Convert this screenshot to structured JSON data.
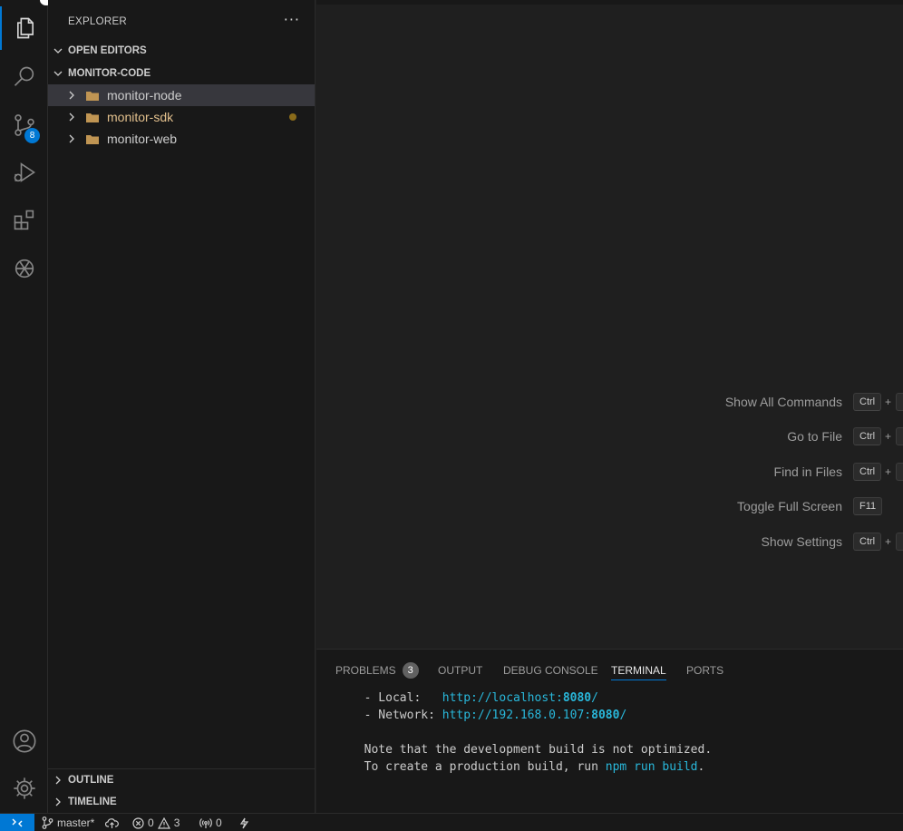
{
  "activity_bar": {
    "items": [
      {
        "icon": "files-icon"
      },
      {
        "icon": "search-icon"
      },
      {
        "icon": "source-control-icon",
        "badge": "8"
      },
      {
        "icon": "run-debug-icon"
      },
      {
        "icon": "extensions-icon"
      },
      {
        "icon": "openai-icon"
      }
    ],
    "bottom": [
      {
        "icon": "account-icon"
      },
      {
        "icon": "gear-icon"
      }
    ]
  },
  "sidebar": {
    "title": "EXPLORER",
    "more": "···",
    "open_editors": "OPEN EDITORS",
    "workspace": "MONITOR-CODE",
    "folders": [
      {
        "name": "monitor-node",
        "color": "#cccccc",
        "selected": true
      },
      {
        "name": "monitor-sdk",
        "color": "#e2c08d",
        "modified": true
      },
      {
        "name": "monitor-web",
        "color": "#cccccc"
      }
    ],
    "outline": "OUTLINE",
    "timeline": "TIMELINE"
  },
  "editor": {
    "commands": [
      {
        "label": "Show All Commands",
        "key": "Ctrl",
        "plus": "+"
      },
      {
        "label": "Go to File",
        "key": "Ctrl",
        "plus": "+"
      },
      {
        "label": "Find in Files",
        "key": "Ctrl",
        "plus": "+"
      },
      {
        "label": "Toggle Full Screen",
        "key": "F11"
      },
      {
        "label": "Show Settings",
        "key": "Ctrl",
        "plus": "+"
      }
    ]
  },
  "panel": {
    "tabs": {
      "problems": "PROBLEMS",
      "problems_count": "3",
      "output": "OUTPUT",
      "debug_console": "DEBUG CONSOLE",
      "terminal": "TERMINAL",
      "ports": "PORTS"
    },
    "terminal": {
      "local_label": "  - Local:   ",
      "local_url_prefix": "http://localhost:",
      "local_port": "8080",
      "local_suffix": "/",
      "network_label": "  - Network: ",
      "network_url_prefix": "http://192.168.0.107:",
      "network_port": "8080",
      "network_suffix": "/",
      "note1": "  Note that the development build is not optimized.",
      "note2_prefix": "  To create a production build, run ",
      "note2_cmd": "npm run build",
      "note2_suffix": "."
    }
  },
  "status_bar": {
    "branch": "master*",
    "errors": "0",
    "warnings": "3",
    "ports": "0",
    "accent": "#0078d4"
  }
}
